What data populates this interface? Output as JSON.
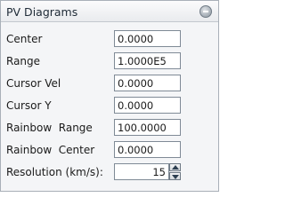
{
  "panel": {
    "title": "PV Diagrams"
  },
  "fields": [
    {
      "label": "Center",
      "value": "0.0000"
    },
    {
      "label": "Range",
      "value": "1.0000E5"
    },
    {
      "label": "Cursor Vel",
      "value": "0.0000"
    },
    {
      "label": "Cursor Y",
      "value": "0.0000"
    },
    {
      "label": "Rainbow  Range",
      "value": "100.0000"
    },
    {
      "label": "Rainbow  Center",
      "value": "0.0000"
    }
  ],
  "resolution": {
    "label": "Resolution (km/s):",
    "value": "15"
  }
}
